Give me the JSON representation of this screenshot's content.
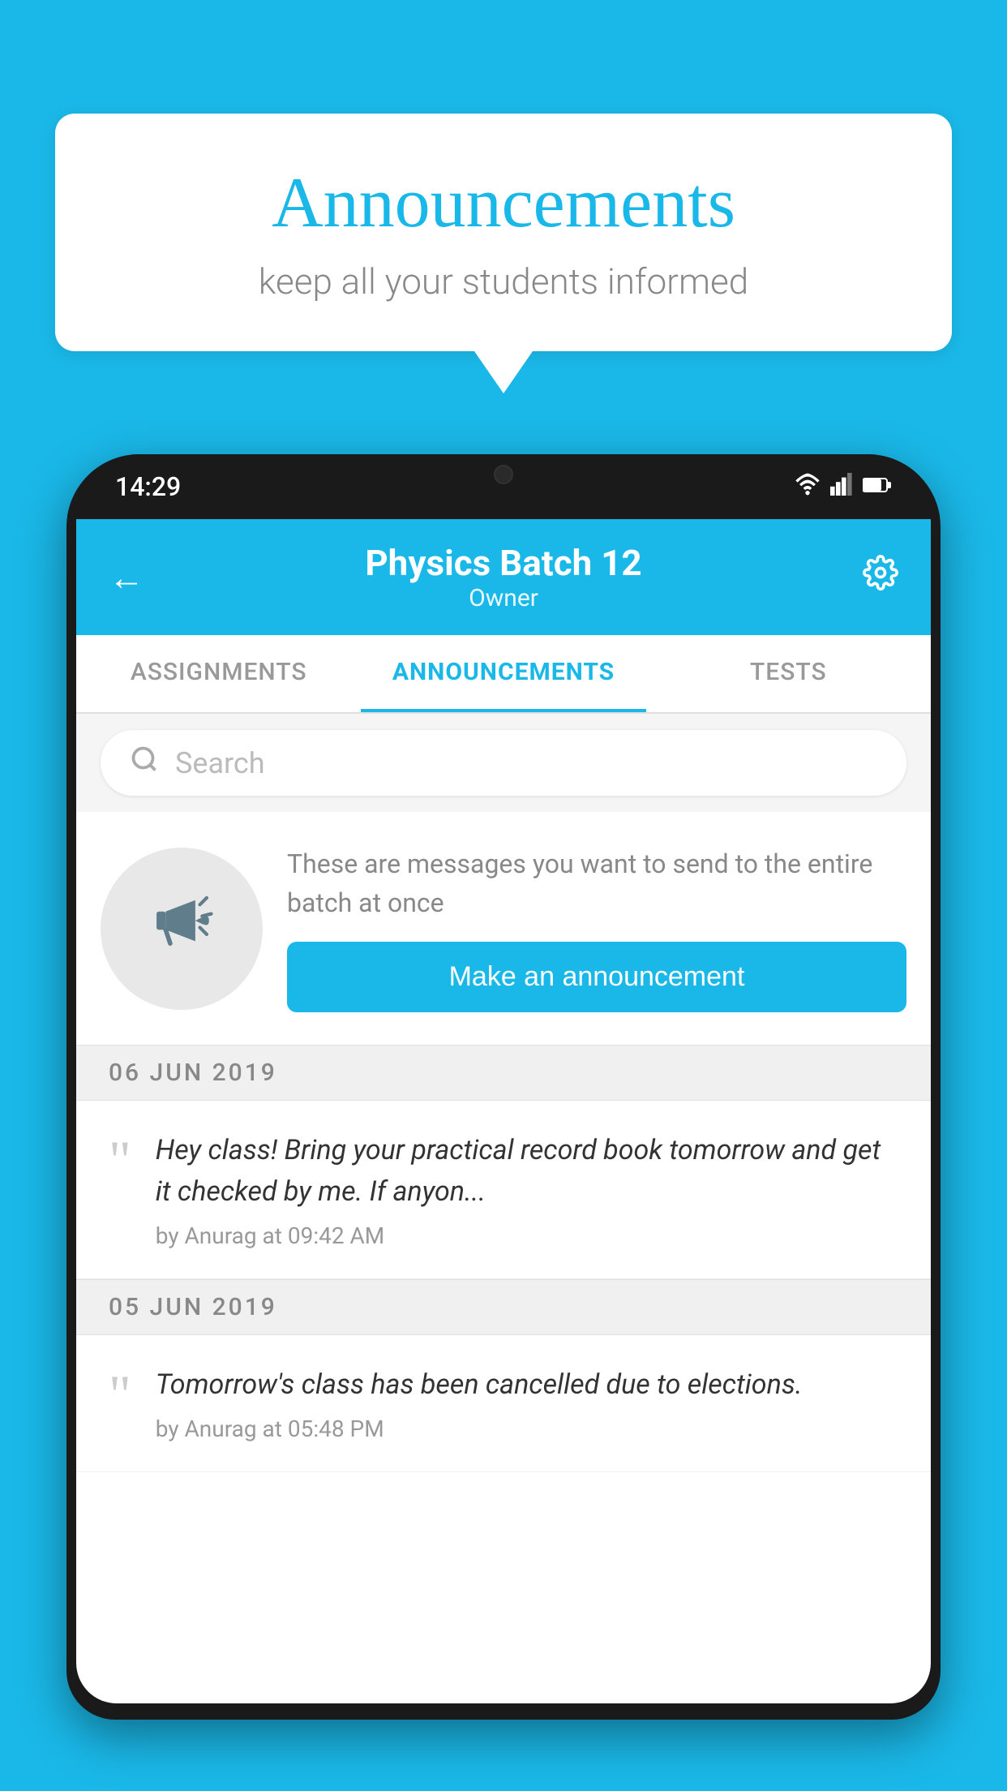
{
  "background_color": "#1ab8e8",
  "bubble": {
    "title": "Announcements",
    "subtitle": "keep all your students informed"
  },
  "status_bar": {
    "time": "14:29",
    "icons": [
      "wifi",
      "signal",
      "battery"
    ]
  },
  "app_header": {
    "title": "Physics Batch 12",
    "subtitle": "Owner",
    "back_label": "←",
    "settings_label": "⚙"
  },
  "tabs": [
    {
      "label": "ASSIGNMENTS",
      "active": false
    },
    {
      "label": "ANNOUNCEMENTS",
      "active": true
    },
    {
      "label": "TESTS",
      "active": false
    }
  ],
  "search": {
    "placeholder": "Search"
  },
  "promo": {
    "description": "These are messages you want to send to the entire batch at once",
    "button_label": "Make an announcement"
  },
  "announcements": [
    {
      "date": "06  JUN  2019",
      "text": "Hey class! Bring your practical record book tomorrow and get it checked by me. If anyon...",
      "meta": "by Anurag at 09:42 AM"
    },
    {
      "date": "05  JUN  2019",
      "text": "Tomorrow's class has been cancelled due to elections.",
      "meta": "by Anurag at 05:48 PM"
    }
  ]
}
